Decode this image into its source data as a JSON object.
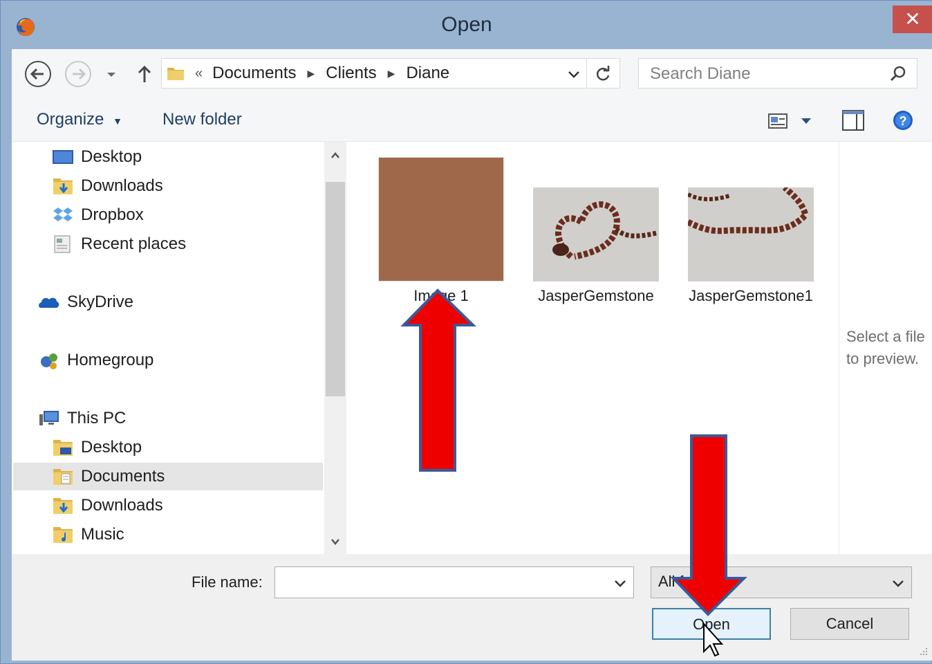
{
  "window": {
    "title": "Open",
    "close_label": "✕"
  },
  "navigation": {
    "breadcrumb": {
      "overflow": "«",
      "items": [
        "Documents",
        "Clients",
        "Diane"
      ]
    },
    "search_placeholder": "Search Diane"
  },
  "toolbar": {
    "organize_label": "Organize",
    "new_folder_label": "New folder"
  },
  "nav_pane": {
    "items": [
      {
        "label": "Desktop",
        "icon": "desktop-icon"
      },
      {
        "label": "Downloads",
        "icon": "downloads-folder-icon"
      },
      {
        "label": "Dropbox",
        "icon": "dropbox-icon"
      },
      {
        "label": "Recent places",
        "icon": "recent-places-icon"
      },
      {
        "label": "SkyDrive",
        "icon": "skydrive-icon"
      },
      {
        "label": "Homegroup",
        "icon": "homegroup-icon"
      },
      {
        "label": "This PC",
        "icon": "this-pc-icon"
      },
      {
        "label": "Desktop",
        "icon": "desktop-folder-icon"
      },
      {
        "label": "Documents",
        "icon": "documents-folder-icon",
        "selected": true
      },
      {
        "label": "Downloads",
        "icon": "downloads-folder-icon"
      },
      {
        "label": "Music",
        "icon": "music-folder-icon"
      }
    ]
  },
  "files": [
    {
      "name": "Image 1",
      "color": "#a0684a"
    },
    {
      "name": "JasperGemstone"
    },
    {
      "name": "JasperGemstone1"
    }
  ],
  "preview": {
    "line1": "Select a file",
    "line2": "to preview."
  },
  "bottom": {
    "file_name_label": "File name:",
    "file_name_value": "",
    "filter_value": "All f",
    "open_label": "Open",
    "cancel_label": "Cancel"
  },
  "annotations": {
    "arrow_color": "#ee0000",
    "arrow_outline": "#3a5a98"
  }
}
